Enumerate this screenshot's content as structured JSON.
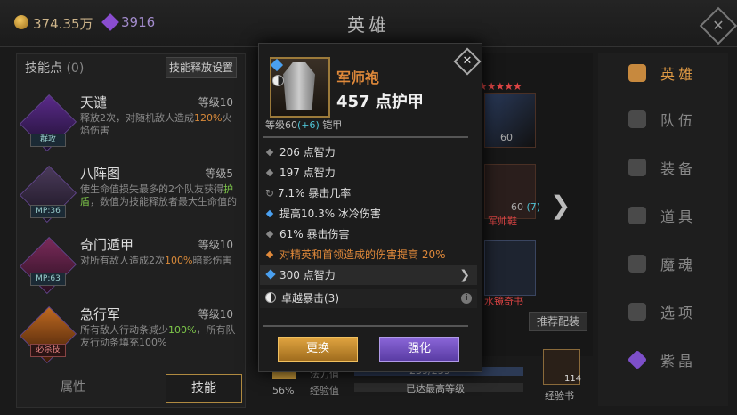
{
  "currency": {
    "gold": "374.35万",
    "gems": "3916"
  },
  "page_title": "英雄",
  "skills_panel": {
    "title": "技能点",
    "count": "(0)",
    "release_settings": "技能释放设置",
    "skills": [
      {
        "name": "天谴",
        "level": "等级10",
        "desc_a": "释放2次，对随机敌人造成",
        "desc_hl": "120%",
        "desc_b": "火焰伤害",
        "tag": "群攻"
      },
      {
        "name": "八阵图",
        "level": "等级5",
        "desc_a": "使生命值损失最多的2个队友获得",
        "desc_hl": "护盾",
        "desc_b": "，数值为技能释放者最大生命值的",
        "tag": "MP:36"
      },
      {
        "name": "奇门遁甲",
        "level": "等级10",
        "desc_a": "对所有敌人造成2次",
        "desc_hl": "100%",
        "desc_b": "暗影伤害",
        "tag": "MP:63"
      },
      {
        "name": "急行军",
        "level": "等级10",
        "desc_a": "所有敌人行动条减少",
        "desc_hl": "100%",
        "desc_b": "，所有队友行动条填充100%",
        "tag": "必杀技"
      }
    ],
    "tabs": {
      "attributes": "属性",
      "skills": "技能"
    }
  },
  "nav": [
    "英雄",
    "队伍",
    "装备",
    "道具",
    "魔魂",
    "选项",
    "紫晶"
  ],
  "hero_area": {
    "slot1_level": "60",
    "slot2_level": "60",
    "slot2_plus": "(7)",
    "slot2_name": "军帅鞋",
    "slot3_name": "水镜奇书",
    "recommend": "推荐配装",
    "exp_percent": "56%",
    "mana_label": "法力值",
    "mana_value": "239/239",
    "exp_label": "经验值",
    "exp_value": "已达最高等级",
    "exp_book_count": "114",
    "exp_book_label": "经验书"
  },
  "item_modal": {
    "name": "军师袍",
    "armor": "457 点护甲",
    "level_prefix": "等级60",
    "level_plus": "(+6)",
    "type": "铠甲",
    "stats": [
      {
        "text": "206 点智力",
        "kind": "plain"
      },
      {
        "text": "197 点智力",
        "kind": "plain"
      },
      {
        "text": "7.1% 暴击几率",
        "kind": "crit"
      },
      {
        "text": "提高10.3% 冰冷伤害",
        "kind": "blue"
      },
      {
        "text": "61% 暴击伤害",
        "kind": "plain"
      },
      {
        "text": "对精英和首领造成的伤害提高 20%",
        "kind": "orange"
      }
    ],
    "gem_socket": "300 点智力",
    "set_bonus": "卓越暴击(3)",
    "replace_button": "更换",
    "enhance_button": "强化"
  },
  "colors": {
    "orange": "#e0893a",
    "blue_gem": "#4aa0f0",
    "purple": "#7d4fc9",
    "gold_button": "#c88a2e",
    "purple_button": "#6e4fc0"
  }
}
